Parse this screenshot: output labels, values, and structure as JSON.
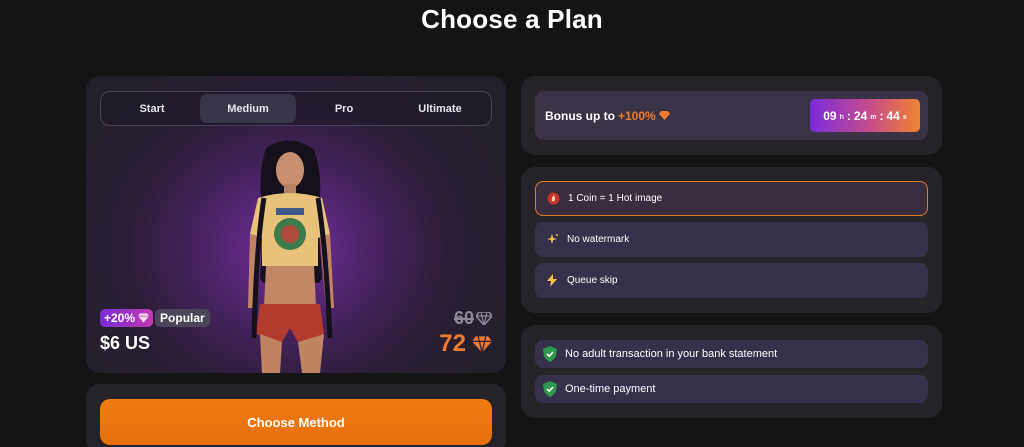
{
  "page": {
    "title": "Choose a Plan"
  },
  "plan_tabs": [
    {
      "label": "Start",
      "active": false
    },
    {
      "label": "Medium",
      "active": true
    },
    {
      "label": "Pro",
      "active": false
    },
    {
      "label": "Ultimate",
      "active": false
    }
  ],
  "plan": {
    "bonus_badge": "+20%",
    "popular_label": "Popular",
    "price": "$6 US",
    "old_coins": "60",
    "new_coins": "72"
  },
  "method_button": {
    "label": "Choose Method"
  },
  "bonus": {
    "prefix": "Bonus up to",
    "highlight": "+100%",
    "timer": {
      "hours": "09",
      "hours_unit": "h",
      "minutes": "24",
      "minutes_unit": "m",
      "seconds": "44",
      "seconds_unit": "s"
    }
  },
  "features": [
    {
      "label": "1 Coin = 1 Hot image",
      "icon": "flame-coin-icon",
      "selected": true
    },
    {
      "label": "No watermark",
      "icon": "sparkle-icon",
      "selected": false
    },
    {
      "label": "Queue skip",
      "icon": "lightning-icon",
      "selected": false
    }
  ],
  "trust": [
    {
      "label": "No adult transaction in your bank statement",
      "icon": "shield-check-icon"
    },
    {
      "label": "One-time payment",
      "icon": "shield-check-icon"
    }
  ],
  "colors": {
    "accent_orange": "#f07a2e",
    "accent_purple": "#7b2bdc",
    "background": "#141414",
    "card": "#252228",
    "row": "#36304a"
  }
}
